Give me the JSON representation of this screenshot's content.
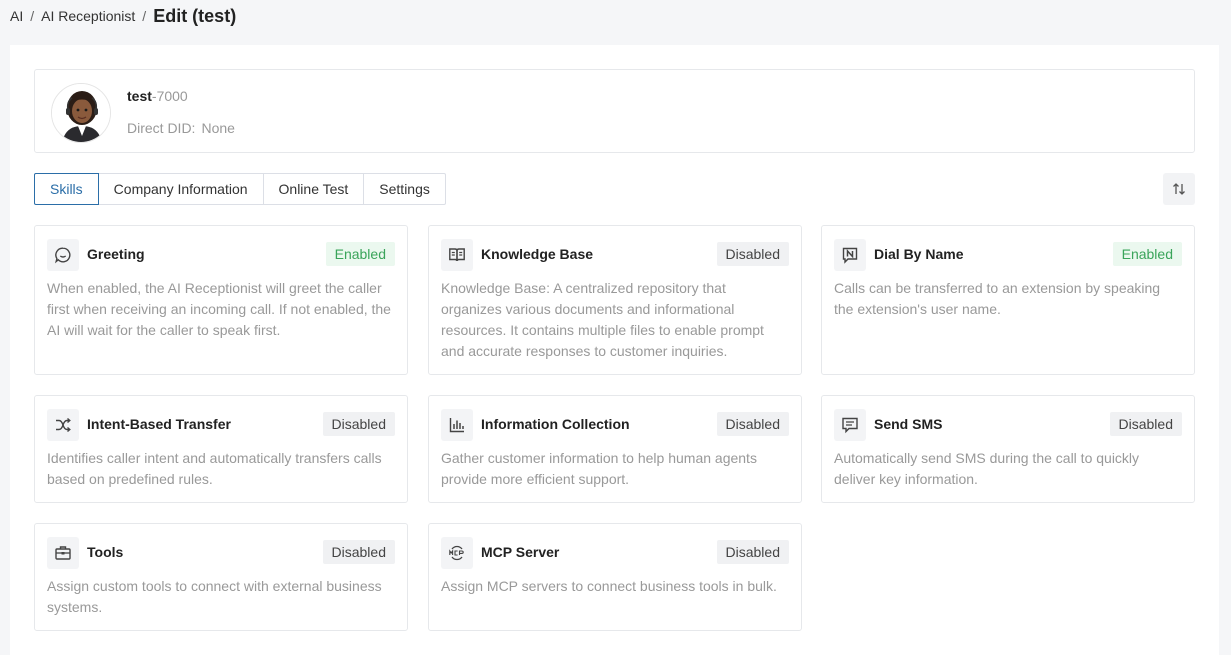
{
  "breadcrumb": {
    "items": [
      "AI",
      "AI Receptionist"
    ],
    "current": "Edit (test)"
  },
  "profile": {
    "name": "test",
    "extension": "-7000",
    "did_label": "Direct DID:",
    "did_value": "None"
  },
  "tabs": [
    {
      "label": "Skills",
      "active": true
    },
    {
      "label": "Company Information",
      "active": false
    },
    {
      "label": "Online Test",
      "active": false
    },
    {
      "label": "Settings",
      "active": false
    }
  ],
  "skills": [
    {
      "title": "Greeting",
      "status": "Enabled",
      "icon": "chat-bubble-icon",
      "desc": "When enabled, the AI Receptionist will greet the caller first when receiving an incoming call. If not enabled, the AI will wait for the caller to speak first."
    },
    {
      "title": "Knowledge Base",
      "status": "Disabled",
      "icon": "book-icon",
      "desc": "Knowledge Base: A centralized repository that organizes various documents and informational resources. It contains multiple files to enable prompt and accurate responses to customer inquiries."
    },
    {
      "title": "Dial By Name",
      "status": "Enabled",
      "icon": "name-badge-icon",
      "desc": "Calls can be transferred to an extension by speaking the extension's user name."
    },
    {
      "title": "Intent-Based Transfer",
      "status": "Disabled",
      "icon": "shuffle-icon",
      "desc": "Identifies caller intent and automatically transfers calls based on predefined rules."
    },
    {
      "title": "Information Collection",
      "status": "Disabled",
      "icon": "bar-chart-icon",
      "desc": "Gather customer information to help human agents provide more efficient support."
    },
    {
      "title": "Send SMS",
      "status": "Disabled",
      "icon": "message-icon",
      "desc": "Automatically send SMS during the call to quickly deliver key information."
    },
    {
      "title": "Tools",
      "status": "Disabled",
      "icon": "toolbox-icon",
      "desc": "Assign custom tools to connect with external business systems."
    },
    {
      "title": "MCP Server",
      "status": "Disabled",
      "icon": "mcp-icon",
      "desc": "Assign MCP servers to connect business tools in bulk."
    }
  ],
  "colors": {
    "accent": "#2b6ea8",
    "enabled_text": "#3aa45a",
    "enabled_bg": "#ebf8ef",
    "disabled_bg": "#f0f1f3"
  }
}
